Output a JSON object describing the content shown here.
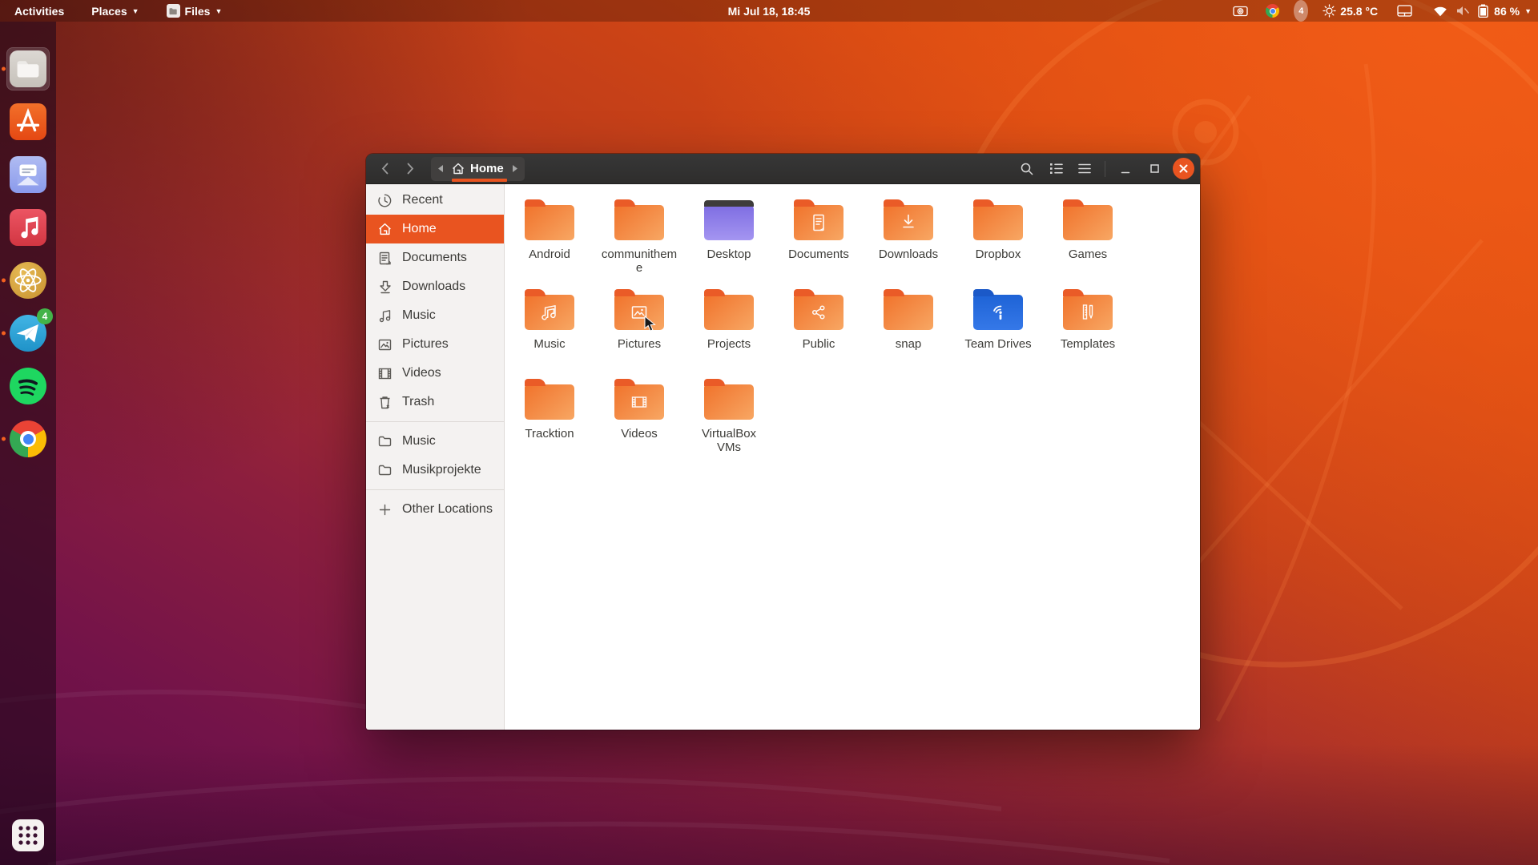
{
  "colors": {
    "accent": "#e95420",
    "folder_body": "#f48f4a",
    "folder_tab": "#ea5b27",
    "desktop_folder": "#8e7de8",
    "teamdrive_folder": "#2569dc",
    "headerbar_bg": "#2e2d2c",
    "sidebar_bg": "#f4f2f1",
    "selection_bg": "#e95420",
    "wallpaper_top_right": "#e8540f",
    "wallpaper_bottom_left": "#5e0f46"
  },
  "topbar": {
    "activities_label": "Activities",
    "places_label": "Places",
    "files_label": "Files",
    "clock": "Mi Jul 18, 18:45",
    "tray": {
      "keyboard_badge": "4",
      "temperature": "25.8 °C",
      "battery_percent": "86 %"
    }
  },
  "dock": {
    "items": [
      {
        "id": "files",
        "running": true,
        "active": true
      },
      {
        "id": "ubuntu-software",
        "running": false
      },
      {
        "id": "geary-mail",
        "running": false
      },
      {
        "id": "gnome-music",
        "running": false
      },
      {
        "id": "atom",
        "running": true
      },
      {
        "id": "telegram",
        "running": true,
        "badge": "4"
      },
      {
        "id": "spotify",
        "running": false
      },
      {
        "id": "chrome",
        "running": true
      }
    ]
  },
  "window": {
    "headerbar": {
      "path_label": "Home"
    },
    "sidebar": {
      "items": [
        {
          "icon": "recent",
          "label": "Recent",
          "selected": false
        },
        {
          "icon": "home",
          "label": "Home",
          "selected": true
        },
        {
          "icon": "documents",
          "label": "Documents",
          "selected": false
        },
        {
          "icon": "downloads",
          "label": "Downloads",
          "selected": false
        },
        {
          "icon": "music",
          "label": "Music",
          "selected": false
        },
        {
          "icon": "pictures",
          "label": "Pictures",
          "selected": false
        },
        {
          "icon": "videos",
          "label": "Videos",
          "selected": false
        },
        {
          "icon": "trash",
          "label": "Trash",
          "selected": false
        }
      ],
      "bookmarks": [
        {
          "icon": "folder",
          "label": "Music"
        },
        {
          "icon": "folder",
          "label": "Musikprojekte"
        }
      ],
      "footer": [
        {
          "icon": "plus",
          "label": "Other Locations"
        }
      ]
    },
    "files": [
      {
        "name": "Android",
        "style": "default",
        "emblem": null
      },
      {
        "name": "communitheme",
        "style": "default",
        "emblem": null
      },
      {
        "name": "Desktop",
        "style": "desktop",
        "emblem": null
      },
      {
        "name": "Documents",
        "style": "default",
        "emblem": "document"
      },
      {
        "name": "Downloads",
        "style": "default",
        "emblem": "download"
      },
      {
        "name": "Dropbox",
        "style": "default",
        "emblem": null
      },
      {
        "name": "Games",
        "style": "default",
        "emblem": null
      },
      {
        "name": "Music",
        "style": "default",
        "emblem": "music"
      },
      {
        "name": "Pictures",
        "style": "default",
        "emblem": "image",
        "cursor": true
      },
      {
        "name": "Projects",
        "style": "default",
        "emblem": null
      },
      {
        "name": "Public",
        "style": "default",
        "emblem": "share"
      },
      {
        "name": "snap",
        "style": "default",
        "emblem": null
      },
      {
        "name": "Team Drives",
        "style": "teamdrive",
        "emblem": "teamdrive"
      },
      {
        "name": "Templates",
        "style": "default",
        "emblem": "template"
      },
      {
        "name": "Tracktion",
        "style": "default",
        "emblem": null
      },
      {
        "name": "Videos",
        "style": "default",
        "emblem": "video"
      },
      {
        "name": "VirtualBox VMs",
        "style": "default",
        "emblem": null
      }
    ]
  }
}
